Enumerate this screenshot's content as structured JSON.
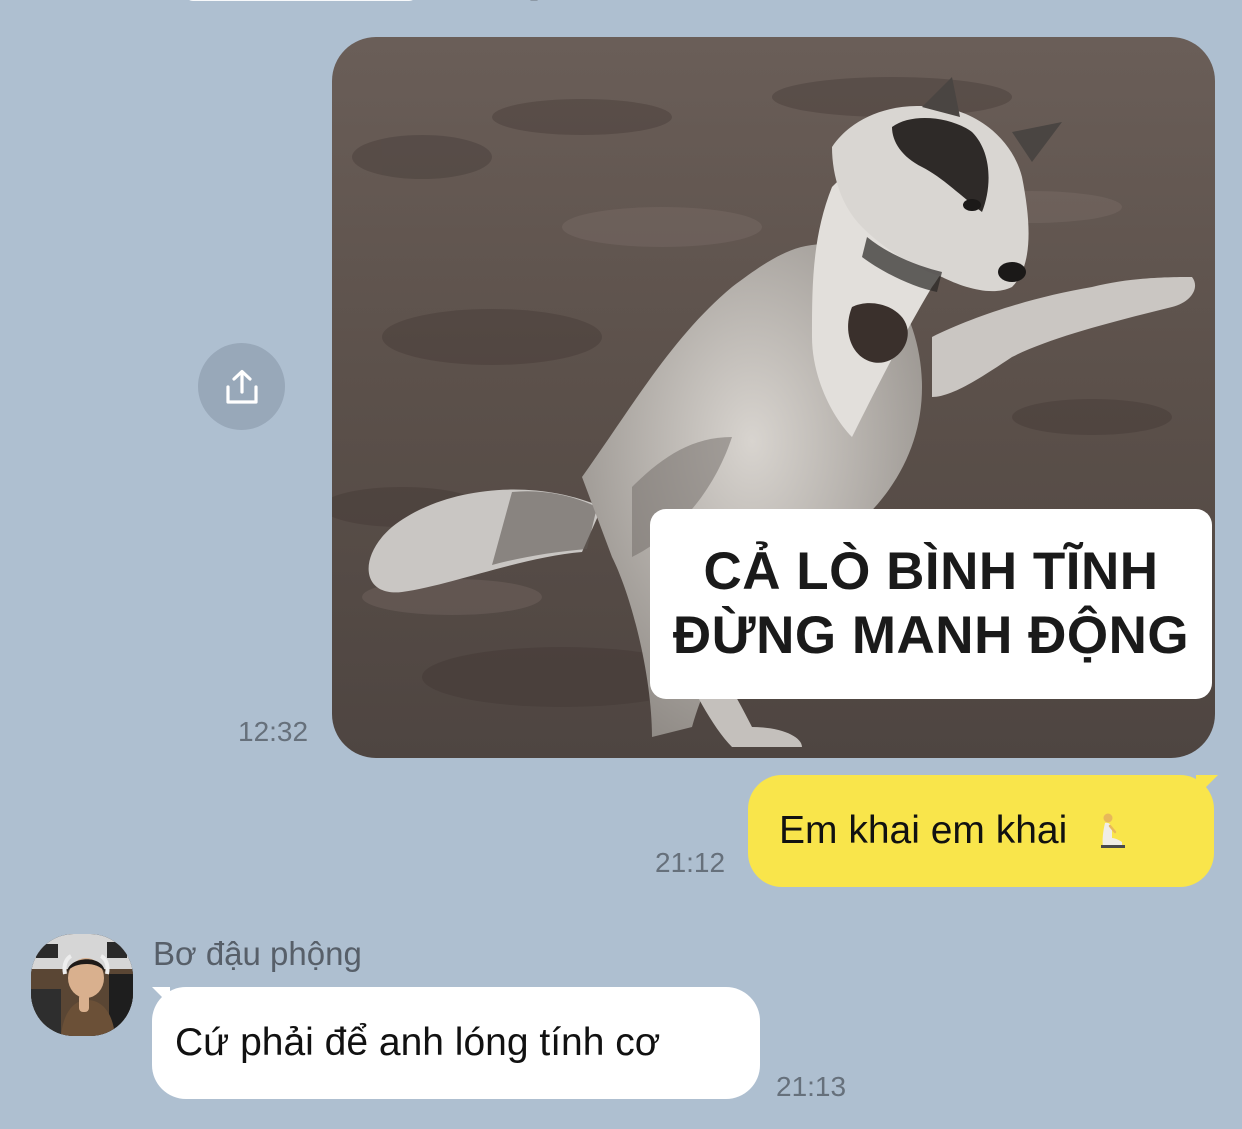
{
  "colors": {
    "background": "#AEBFD0",
    "outgoing_bubble": "#F9E54B",
    "incoming_bubble": "#FFFFFF",
    "share_button": "#98A8B9",
    "timestamp": "#66707B"
  },
  "share_button": {
    "icon": "share-icon"
  },
  "image_message": {
    "caption_line1": "CẢ LÒ BÌNH TĨNH",
    "caption_line2": "ĐỪNG MANH ĐỘNG",
    "time": "12:32"
  },
  "outgoing_message": {
    "text": "Em khai em khai",
    "emoji": "person-kneeling-emoji",
    "time": "21:12"
  },
  "incoming_message": {
    "sender": "Bơ đậu phộng",
    "text": "Cứ phải để anh lóng tính cơ",
    "time": "21:13",
    "avatar": "avatar-photo"
  }
}
